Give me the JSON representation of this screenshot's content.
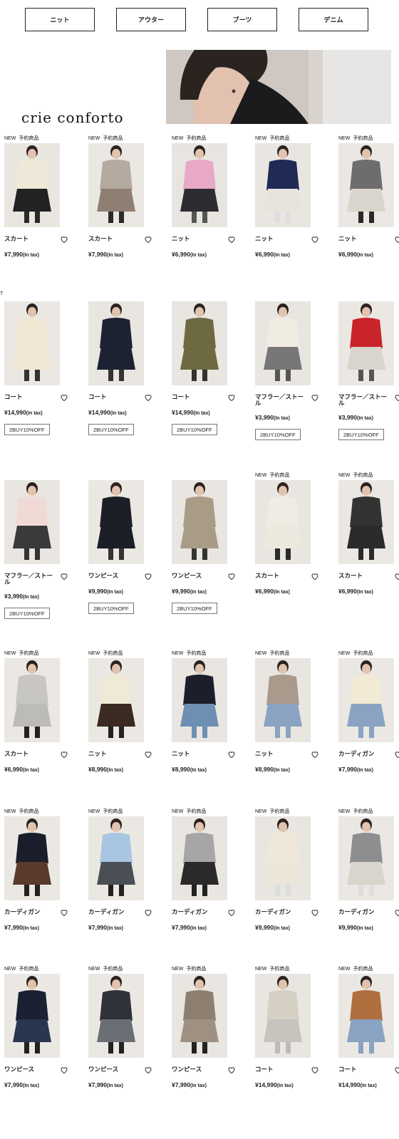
{
  "categories": [
    "ニット",
    "アウター",
    "ブーツ",
    "デニム"
  ],
  "banner": {
    "logo": "crie conforto"
  },
  "rows": [
    {
      "title": "",
      "items": [
        {
          "tags": [
            "NEW",
            "予約商品"
          ],
          "name": "スカート",
          "price": "¥7,990",
          "tax": "(In tax)",
          "badge": "",
          "img": {
            "bg": "#e9e6e0",
            "top": "#efe7d8",
            "bottom": "#222222",
            "legs": "#2a2a2a"
          }
        },
        {
          "tags": [
            "NEW",
            "予約商品"
          ],
          "name": "スカート",
          "price": "¥7,990",
          "tax": "(In tax)",
          "badge": "",
          "img": {
            "bg": "#ebe8e3",
            "top": "#b5aaa0",
            "bottom": "#8e7f72",
            "legs": "#2a2a2a"
          }
        },
        {
          "tags": [
            "NEW",
            "予約商品"
          ],
          "name": "ニット",
          "price": "¥6,990",
          "tax": "(In tax)",
          "badge": "",
          "img": {
            "bg": "#e8e5e1",
            "top": "#e8a8c8",
            "bottom": "#2c2c32",
            "legs": "#555"
          }
        },
        {
          "tags": [
            "NEW",
            "予約商品"
          ],
          "name": "ニット",
          "price": "¥6,990",
          "tax": "(In tax)",
          "badge": "",
          "img": {
            "bg": "#e9e6e2",
            "top": "#1f2a55",
            "bottom": "#e8e4dc",
            "legs": "#ddd"
          }
        },
        {
          "tags": [
            "NEW",
            "予約商品"
          ],
          "name": "ニット",
          "price": "¥6,990",
          "tax": "(In tax)",
          "badge": "",
          "img": {
            "bg": "#ebe8e4",
            "top": "#6d6d6d",
            "bottom": "#d9d4cc",
            "legs": "#2a2a2a"
          }
        }
      ]
    },
    {
      "title": "T",
      "items": [
        {
          "tags": [],
          "name": "コート",
          "price": "¥14,990",
          "tax": "(In tax)",
          "badge": "2BUY10%OFF",
          "img": {
            "bg": "#ebe8e3",
            "top": "#efe6d4",
            "bottom": "#efe6d4",
            "legs": "#333"
          }
        },
        {
          "tags": [],
          "name": "コート",
          "price": "¥14,990",
          "tax": "(In tax)",
          "badge": "2BUY10%OFF",
          "img": {
            "bg": "#e9e6e1",
            "top": "#1d2233",
            "bottom": "#1d2233",
            "legs": "#333"
          }
        },
        {
          "tags": [],
          "name": "コート",
          "price": "¥14,990",
          "tax": "(In tax)",
          "badge": "2BUY10%OFF",
          "img": {
            "bg": "#e9e6e1",
            "top": "#6d6a42",
            "bottom": "#6d6a42",
            "legs": "#333"
          }
        },
        {
          "tags": [],
          "name": "マフラー／ストール",
          "price": "¥3,990",
          "tax": "(In tax)",
          "badge": "2BUY10%OFF",
          "img": {
            "bg": "#e9e6e1",
            "top": "#f0ece2",
            "bottom": "#777",
            "legs": "#555"
          }
        },
        {
          "tags": [],
          "name": "マフラー／ストール",
          "price": "¥3,990",
          "tax": "(In tax)",
          "badge": "2BUY10%OFF",
          "img": {
            "bg": "#ebe8e3",
            "top": "#c8242a",
            "bottom": "#d9d4cc",
            "legs": "#555"
          }
        }
      ]
    },
    {
      "title": "",
      "items": [
        {
          "tags": [],
          "name": "マフラー／ストール",
          "price": "¥3,990",
          "tax": "(In tax)",
          "badge": "2BUY10%OFF",
          "img": {
            "bg": "#e9e6e1",
            "top": "#f1d9d6",
            "bottom": "#3a3a3a",
            "legs": "#333"
          }
        },
        {
          "tags": [],
          "name": "ワンピース",
          "price": "¥9,990",
          "tax": "(In tax)",
          "badge": "2BUY10%OFF",
          "img": {
            "bg": "#ebe8e3",
            "top": "#1c1e28",
            "bottom": "#1c1e28",
            "legs": "#333"
          }
        },
        {
          "tags": [],
          "name": "ワンピース",
          "price": "¥9,990",
          "tax": "(In tax)",
          "badge": "2BUY10%OFF",
          "img": {
            "bg": "#e9e6e1",
            "top": "#a99c86",
            "bottom": "#a99c86",
            "legs": "#333"
          }
        },
        {
          "tags": [
            "NEW",
            "予約商品"
          ],
          "name": "スカート",
          "price": "¥6,990",
          "tax": "(In tax)",
          "badge": "",
          "img": {
            "bg": "#e9e6e1",
            "top": "#efece3",
            "bottom": "#ece8dd",
            "legs": "#2a2a2a"
          }
        },
        {
          "tags": [
            "NEW",
            "予約商品"
          ],
          "name": "スカート",
          "price": "¥6,990",
          "tax": "(In tax)",
          "badge": "",
          "img": {
            "bg": "#ebe8e4",
            "top": "#333",
            "bottom": "#2b2b2b",
            "legs": "#2a2a2a"
          }
        }
      ]
    },
    {
      "title": "",
      "items": [
        {
          "tags": [
            "NEW",
            "予約商品"
          ],
          "name": "スカート",
          "price": "¥6,990",
          "tax": "(In tax)",
          "badge": "",
          "img": {
            "bg": "#ebe8e3",
            "top": "#c8c6c2",
            "bottom": "#bdbbb7",
            "legs": "#222"
          }
        },
        {
          "tags": [
            "NEW",
            "予約商品"
          ],
          "name": "ニット",
          "price": "¥8,990",
          "tax": "(In tax)",
          "badge": "",
          "img": {
            "bg": "#ebe8e3",
            "top": "#efe9d8",
            "bottom": "#3b2a22",
            "legs": "#222"
          }
        },
        {
          "tags": [
            "NEW",
            "予約商品"
          ],
          "name": "ニット",
          "price": "¥8,990",
          "tax": "(In tax)",
          "badge": "",
          "img": {
            "bg": "#e9e6e1",
            "top": "#1c1f2b",
            "bottom": "#6d8fb4",
            "legs": "#6d8fb4"
          }
        },
        {
          "tags": [
            "NEW",
            "予約商品"
          ],
          "name": "ニット",
          "price": "¥8,990",
          "tax": "(In tax)",
          "badge": "",
          "img": {
            "bg": "#e9e6e1",
            "top": "#a99a8c",
            "bottom": "#8aa3c2",
            "legs": "#8aa3c2"
          }
        },
        {
          "tags": [
            "NEW",
            "予約商品"
          ],
          "name": "カーディガン",
          "price": "¥7,990",
          "tax": "(In tax)",
          "badge": "",
          "img": {
            "bg": "#ebe8e3",
            "top": "#f2ead4",
            "bottom": "#8aa3c2",
            "legs": "#8aa3c2"
          }
        }
      ]
    },
    {
      "title": "",
      "items": [
        {
          "tags": [
            "NEW",
            "予約商品"
          ],
          "name": "カーディガン",
          "price": "¥7,990",
          "tax": "(In tax)",
          "badge": "",
          "img": {
            "bg": "#ebe8e3",
            "top": "#1a1d2a",
            "bottom": "#5a3a2c",
            "legs": "#222"
          }
        },
        {
          "tags": [
            "NEW",
            "予約商品"
          ],
          "name": "カーディガン",
          "price": "¥7,990",
          "tax": "(In tax)",
          "badge": "",
          "img": {
            "bg": "#ebe8e3",
            "top": "#a8c6e2",
            "bottom": "#4a4f55",
            "legs": "#222"
          }
        },
        {
          "tags": [
            "NEW",
            "予約商品"
          ],
          "name": "カーディガン",
          "price": "¥7,990",
          "tax": "(In tax)",
          "badge": "",
          "img": {
            "bg": "#e9e6e1",
            "top": "#a6a6a6",
            "bottom": "#2a2a2a",
            "legs": "#222"
          }
        },
        {
          "tags": [
            "NEW",
            "予約商品"
          ],
          "name": "カーディガン",
          "price": "¥9,990",
          "tax": "(In tax)",
          "badge": "",
          "img": {
            "bg": "#e9e6e1",
            "top": "#efe8d8",
            "bottom": "#ece6d9",
            "legs": "#ddd"
          }
        },
        {
          "tags": [
            "NEW",
            "予約商品"
          ],
          "name": "カーディガン",
          "price": "¥9,990",
          "tax": "(In tax)",
          "badge": "",
          "img": {
            "bg": "#ebe8e3",
            "top": "#8c8e90",
            "bottom": "#d9d4cc",
            "legs": "#ddd"
          }
        }
      ]
    },
    {
      "title": "",
      "items": [
        {
          "tags": [
            "NEW",
            "予約商品"
          ],
          "name": "ワンピース",
          "price": "¥7,990",
          "tax": "(In tax)",
          "badge": "",
          "img": {
            "bg": "#ebe8e3",
            "top": "#1b2033",
            "bottom": "#2a3550",
            "legs": "#222"
          }
        },
        {
          "tags": [
            "NEW",
            "予約商品"
          ],
          "name": "ワンピース",
          "price": "¥7,990",
          "tax": "(In tax)",
          "badge": "",
          "img": {
            "bg": "#ebe8e3",
            "top": "#2f3238",
            "bottom": "#6b6e74",
            "legs": "#222"
          }
        },
        {
          "tags": [
            "NEW",
            "予約商品"
          ],
          "name": "ワンピース",
          "price": "¥7,990",
          "tax": "(In tax)",
          "badge": "",
          "img": {
            "bg": "#e9e6e1",
            "top": "#8d7f70",
            "bottom": "#9f9182",
            "legs": "#222"
          }
        },
        {
          "tags": [
            "NEW",
            "予約商品"
          ],
          "name": "コート",
          "price": "¥14,990",
          "tax": "(In tax)",
          "badge": "",
          "img": {
            "bg": "#e9e6e1",
            "top": "#d6d0c4",
            "bottom": "#c7c4be",
            "legs": "#bbb"
          }
        },
        {
          "tags": [
            "NEW",
            "予約商品"
          ],
          "name": "コート",
          "price": "¥14,990",
          "tax": "(In tax)",
          "badge": "",
          "img": {
            "bg": "#ebe8e3",
            "top": "#b06f3f",
            "bottom": "#8aa3c2",
            "legs": "#8aa3c2"
          }
        }
      ]
    }
  ]
}
